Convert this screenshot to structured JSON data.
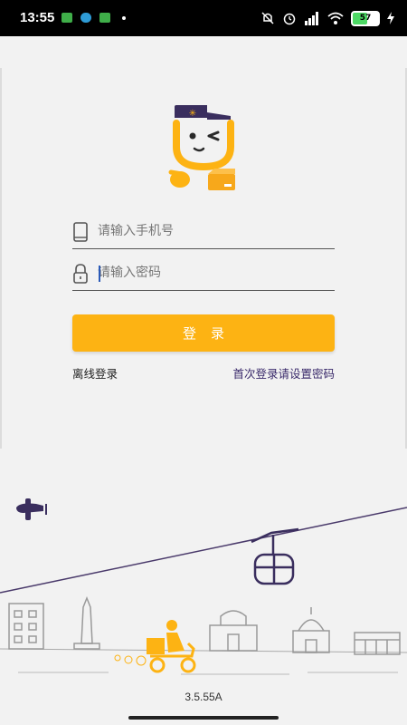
{
  "status_bar": {
    "time": "13:55",
    "battery": "57",
    "icons": [
      "notification-app-icon",
      "notification-app-icon-2",
      "notification-app-icon-3",
      "mute-icon",
      "alarm-icon",
      "signal-icon",
      "wifi-icon",
      "battery-icon",
      "charging-icon"
    ]
  },
  "login_form": {
    "phone_placeholder": "请输入手机号",
    "password_placeholder": "请输入密码",
    "login_label": "登录",
    "offline_login": "离线登录",
    "first_login_set_password": "首次登录请设置密码"
  },
  "footer": {
    "version": "3.5.55A"
  },
  "colors": {
    "accent": "#fdb313",
    "text_dark": "#222222",
    "link": "#3a2a6b",
    "scene_line": "#4a3a6b",
    "background": "#f2f2f2"
  }
}
